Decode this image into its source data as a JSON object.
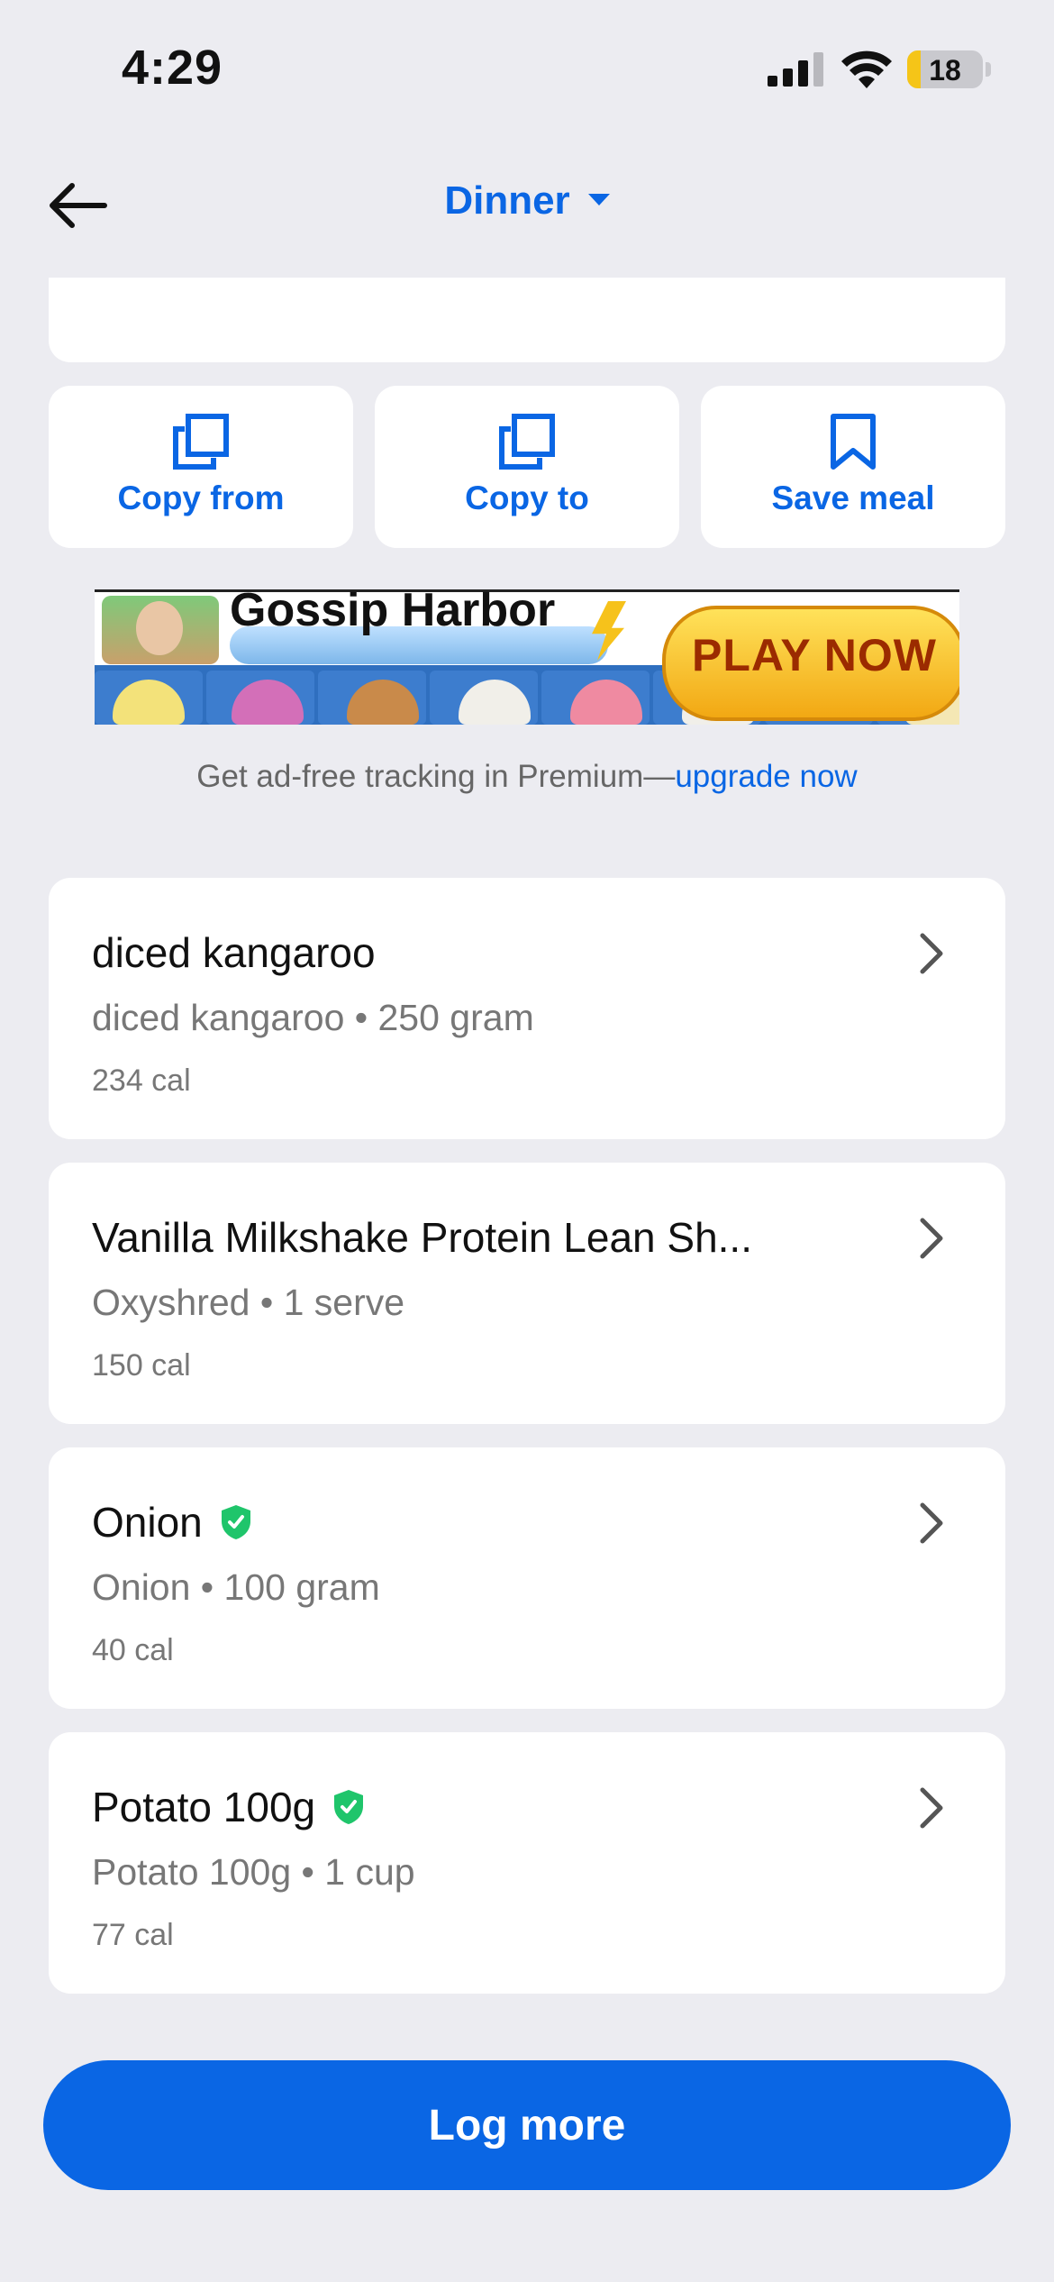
{
  "status_bar": {
    "time": "4:29",
    "battery": "18",
    "battery_fraction": 0.18
  },
  "header": {
    "title": "Dinner"
  },
  "actions": [
    {
      "label": "Copy from",
      "icon": "copy-icon"
    },
    {
      "label": "Copy to",
      "icon": "copy-icon"
    },
    {
      "label": "Save meal",
      "icon": "bookmark-icon"
    }
  ],
  "ad": {
    "title": "Gossip Harbor",
    "cta": "PLAY NOW",
    "note_prefix": "Get ad-free tracking in Premium—",
    "note_link": "upgrade now"
  },
  "food_items": [
    {
      "name": "diced kangaroo",
      "detail": "diced kangaroo • 250 gram",
      "calories": "234 cal",
      "verified": false
    },
    {
      "name": "Vanilla Milkshake Protein Lean Sh...",
      "detail": "Oxyshred • 1 serve",
      "calories": "150 cal",
      "verified": false
    },
    {
      "name": "Onion",
      "detail": "Onion • 100 gram",
      "calories": "40 cal",
      "verified": true
    },
    {
      "name": "Potato 100g",
      "detail": "Potato 100g • 1 cup",
      "calories": "77 cal",
      "verified": true
    }
  ],
  "log_more_label": "Log more",
  "colors": {
    "accent": "#0a66e4",
    "verified": "#1fc56b",
    "background": "#ececf1"
  }
}
